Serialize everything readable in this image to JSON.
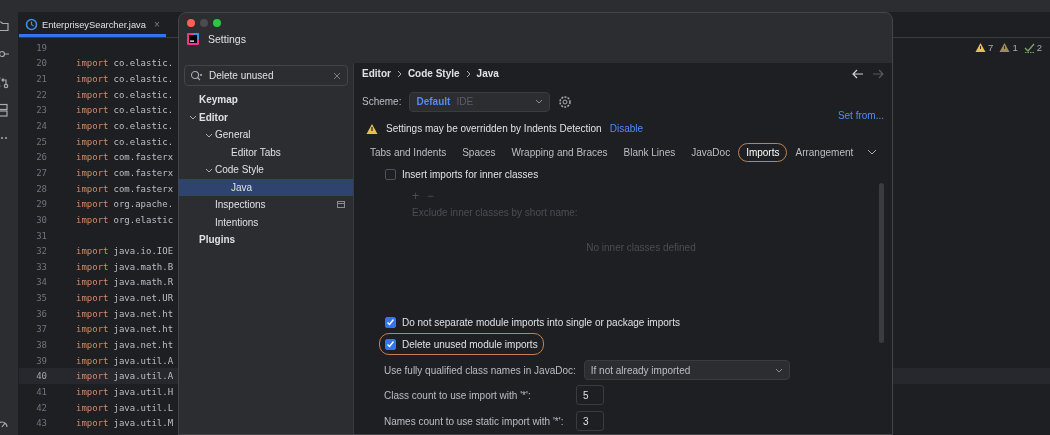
{
  "editor": {
    "tab": {
      "label": "EnterpriseySearcher.java",
      "close": "×",
      "selected": true
    },
    "inspections": [
      {
        "kind": "warning",
        "count": "7"
      },
      {
        "kind": "weak-warning",
        "count": "1"
      },
      {
        "kind": "check",
        "count": "2"
      }
    ],
    "lines": [
      {
        "number": "19",
        "current": false
      },
      {
        "number": "20",
        "keyword": "import",
        "text": "co.elastic.",
        "current": false
      },
      {
        "number": "21",
        "keyword": "import",
        "text": "co.elastic.",
        "current": false
      },
      {
        "number": "22",
        "keyword": "import",
        "text": "co.elastic.",
        "current": false
      },
      {
        "number": "23",
        "keyword": "import",
        "text": "co.elastic.",
        "current": false
      },
      {
        "number": "24",
        "keyword": "import",
        "text": "co.elastic.",
        "current": false
      },
      {
        "number": "25",
        "keyword": "import",
        "text": "co.elastic.",
        "current": false
      },
      {
        "number": "26",
        "keyword": "import",
        "text": "com.fasterx",
        "current": false
      },
      {
        "number": "27",
        "keyword": "import",
        "text": "com.fasterx",
        "current": false
      },
      {
        "number": "28",
        "keyword": "import",
        "text": "com.fasterx",
        "current": false
      },
      {
        "number": "29",
        "keyword": "import",
        "text": "org.apache.",
        "current": false
      },
      {
        "number": "30",
        "keyword": "import",
        "text": "org.elastic",
        "current": false
      },
      {
        "number": "31",
        "current": false
      },
      {
        "number": "32",
        "keyword": "import",
        "text": "java.io.IOE",
        "current": false
      },
      {
        "number": "33",
        "keyword": "import",
        "text": "java.math.B",
        "current": false
      },
      {
        "number": "34",
        "keyword": "import",
        "text": "java.math.R",
        "current": false
      },
      {
        "number": "35",
        "keyword": "import",
        "text": "java.net.UR",
        "current": false
      },
      {
        "number": "36",
        "keyword": "import",
        "text": "java.net.ht",
        "current": false
      },
      {
        "number": "37",
        "keyword": "import",
        "text": "java.net.ht",
        "current": false
      },
      {
        "number": "38",
        "keyword": "import",
        "text": "java.net.ht",
        "current": false
      },
      {
        "number": "39",
        "keyword": "import",
        "text": "java.util.A",
        "current": false
      },
      {
        "number": "40",
        "keyword": "import",
        "text": "java.util.A",
        "current": true
      },
      {
        "number": "41",
        "keyword": "import",
        "text": "java.util.H",
        "current": false
      },
      {
        "number": "42",
        "keyword": "import",
        "text": "java.util.L",
        "current": false
      },
      {
        "number": "43",
        "keyword": "import",
        "text": "java.util.M",
        "current": false
      }
    ]
  },
  "dialog": {
    "title": "Settings",
    "search": {
      "value": "Delete unused"
    },
    "tree": [
      {
        "label": "Keymap",
        "bold": true,
        "selected": false
      },
      {
        "label": "Editor",
        "bold": true,
        "selected": false,
        "expanded": true,
        "children": [
          {
            "label": "General",
            "bold": false,
            "selected": false,
            "expanded": true,
            "children": [
              {
                "label": "Editor Tabs",
                "bold": false,
                "selected": false
              }
            ]
          },
          {
            "label": "Code Style",
            "bold": false,
            "selected": false,
            "expanded": true,
            "children": [
              {
                "label": "Java",
                "bold": false,
                "selected": true
              }
            ]
          },
          {
            "label": "Inspections",
            "bold": false,
            "selected": false,
            "badge": true
          },
          {
            "label": "Intentions",
            "bold": false,
            "selected": false
          }
        ]
      },
      {
        "label": "Plugins",
        "bold": true,
        "selected": false
      }
    ],
    "breadcrumb": [
      "Editor",
      "Code Style",
      "Java"
    ],
    "scheme": {
      "label": "Scheme:",
      "value": "Default",
      "tag": "IDE"
    },
    "set_from": "Set from...",
    "notice": {
      "text": "Settings may be overridden by Indents Detection",
      "link": "Disable"
    },
    "tabs": [
      {
        "label": "Tabs and Indents",
        "selected": false,
        "highlighted": false
      },
      {
        "label": "Spaces",
        "selected": false,
        "highlighted": false
      },
      {
        "label": "Wrapping and Braces",
        "selected": false,
        "highlighted": false
      },
      {
        "label": "Blank Lines",
        "selected": false,
        "highlighted": false
      },
      {
        "label": "JavaDoc",
        "selected": false,
        "highlighted": false
      },
      {
        "label": "Imports",
        "selected": true,
        "highlighted": true
      },
      {
        "label": "Arrangement",
        "selected": false,
        "highlighted": false
      }
    ],
    "inner_option": {
      "label": "Insert imports for inner classes",
      "checked": false,
      "highlighted": false
    },
    "inner_classes": {
      "disabled": true,
      "add": "+",
      "remove": "−",
      "label": "Exclude inner classes by short name:",
      "empty_text": "No inner classes defined"
    },
    "options": [
      {
        "label": "Do not separate module imports into single or package imports",
        "checked": true,
        "highlighted": false
      },
      {
        "label": "Delete unused module imports",
        "checked": true,
        "highlighted": true
      }
    ],
    "javadoc": {
      "label": "Use fully qualified class names in JavaDoc:",
      "value": "If not already imported"
    },
    "counts": [
      {
        "label": "Class count to use import with '*':",
        "value": "5"
      },
      {
        "label": "Names count to use static import with '*':",
        "value": "3"
      }
    ]
  }
}
